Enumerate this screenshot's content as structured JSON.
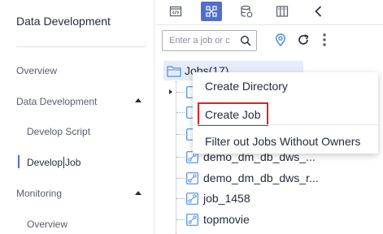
{
  "sidebar": {
    "title": "Data Development",
    "items": [
      {
        "label": "Overview"
      },
      {
        "label": "Data Development"
      },
      {
        "label": "Develop Script"
      },
      {
        "label_a": "Develop",
        "label_b": "Job"
      },
      {
        "label": "Monitoring"
      },
      {
        "label": "Overview"
      }
    ]
  },
  "toolbar": {
    "icons": [
      "code-icon",
      "node-graph-icon",
      "database-icon",
      "file-cabinet-icon",
      "collapse-chevron-icon"
    ],
    "selected_index": 1
  },
  "search": {
    "placeholder": "Enter a job or c",
    "value": ""
  },
  "tree": {
    "root_label": "Jobs(17)",
    "jobs": [
      "demo_dm_db_dws_...",
      "demo_dm_db_dws_r...",
      "job_1458",
      "topmovie"
    ]
  },
  "context_menu": {
    "items": [
      "Create Directory",
      "Create Job",
      "Filter out Jobs Without Owners"
    ],
    "highlighted_item": "Create Job",
    "highlight_color": "#e02020"
  },
  "colors": {
    "accent": "#526ecc",
    "tree_selection": "#e6ecfa",
    "icon_blue": "#4a8ee8"
  }
}
